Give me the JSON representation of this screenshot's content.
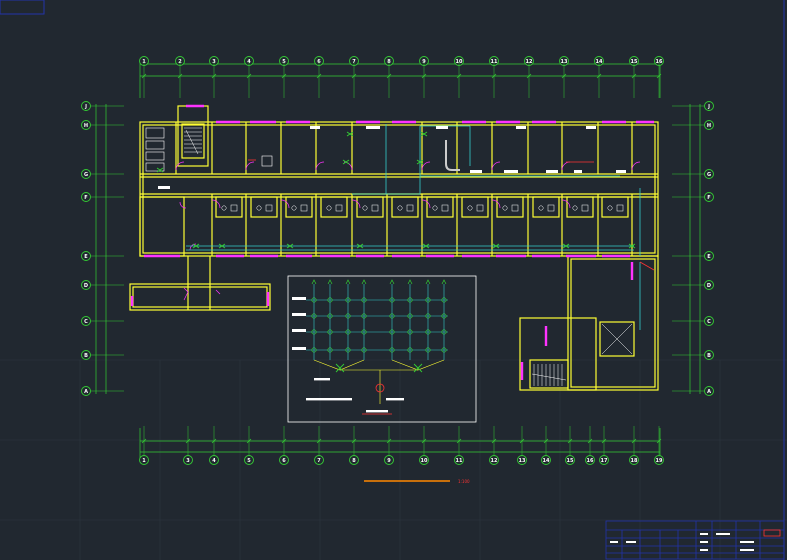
{
  "drawing": {
    "scale_text": "1:100",
    "top_grid_labels": [
      "1",
      "2",
      "3",
      "4",
      "5",
      "6",
      "7",
      "8",
      "9",
      "10",
      "11",
      "12",
      "13",
      "14",
      "15",
      "16"
    ],
    "bottom_grid_labels": [
      "1",
      "3",
      "4",
      "5",
      "6",
      "7",
      "8",
      "9",
      "10",
      "11",
      "12",
      "13",
      "14",
      "15",
      "16",
      "17",
      "18",
      "19"
    ],
    "left_grid_labels": [
      "J",
      "H",
      "G",
      "F",
      "E",
      "D",
      "C",
      "B",
      "A"
    ],
    "right_grid_labels": [
      "J",
      "H",
      "G",
      "F",
      "E",
      "D",
      "C",
      "B",
      "A"
    ]
  },
  "colors": {
    "background": "#212830",
    "wall": "#ffff33",
    "door": "#ff33ff",
    "dimension": "#33cc33",
    "pipe": "#33cccc",
    "frame": "#2233aa",
    "red": "#ff3333",
    "orange": "#ff8800",
    "white": "#ffffff"
  }
}
